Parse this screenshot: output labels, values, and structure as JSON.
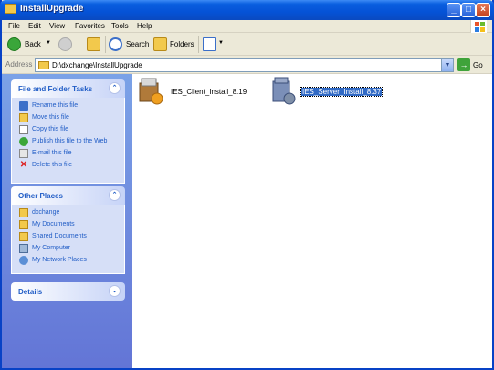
{
  "window": {
    "title": "InstallUpgrade"
  },
  "menu": [
    "File",
    "Edit",
    "View",
    "Favorites",
    "Tools",
    "Help"
  ],
  "toolbar": {
    "back": "Back",
    "search": "Search",
    "folders": "Folders"
  },
  "address": {
    "label": "Address",
    "path": "D:\\dxchange\\InstallUpgrade",
    "go": "Go"
  },
  "tasks": {
    "title": "File and Folder Tasks",
    "items": [
      {
        "label": "Rename this file",
        "icon": "rename-icon"
      },
      {
        "label": "Move this file",
        "icon": "move-icon"
      },
      {
        "label": "Copy this file",
        "icon": "copy-icon"
      },
      {
        "label": "Publish this file to the Web",
        "icon": "globe-icon"
      },
      {
        "label": "E-mail this file",
        "icon": "email-icon"
      },
      {
        "label": "Delete this file",
        "icon": "delete-icon"
      }
    ]
  },
  "places": {
    "title": "Other Places",
    "items": [
      {
        "label": "dxchange",
        "icon": "folder-icon"
      },
      {
        "label": "My Documents",
        "icon": "my-documents-icon"
      },
      {
        "label": "Shared Documents",
        "icon": "shared-folder-icon"
      },
      {
        "label": "My Computer",
        "icon": "computer-icon"
      },
      {
        "label": "My Network Places",
        "icon": "network-icon"
      }
    ]
  },
  "details": {
    "title": "Details"
  },
  "files": [
    {
      "name": "IES_Client_Install_8.19",
      "selected": false
    },
    {
      "name": "IES_Server_Install_8.37",
      "selected": true
    }
  ],
  "colors": {
    "titlebar": "#0552d6",
    "taskpane": "#7ba2e7",
    "selection": "#316ac5",
    "link": "#215dc6"
  }
}
